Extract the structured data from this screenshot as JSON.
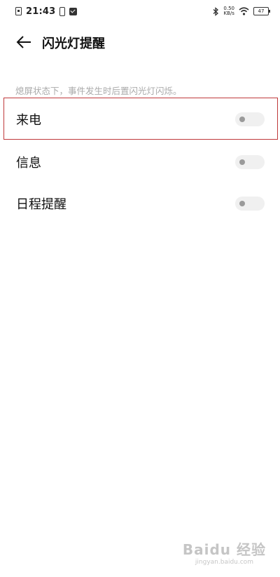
{
  "status_bar": {
    "time": "21:43",
    "speed_value": "0.50",
    "speed_unit": "KB/s",
    "battery": "47"
  },
  "header": {
    "title": "闪光灯提醒"
  },
  "description": "熄屏状态下，事件发生时后置闪光灯闪烁。",
  "settings": [
    {
      "label": "来电",
      "enabled": false
    },
    {
      "label": "信息",
      "enabled": false
    },
    {
      "label": "日程提醒",
      "enabled": false
    }
  ],
  "watermark": {
    "main": "Baidu 经验",
    "sub": "jingyan.baidu.com"
  },
  "colors": {
    "highlight": "#c0393b",
    "toggle_off_track": "#f0f0f0",
    "toggle_off_knob": "#9a9a9a"
  }
}
